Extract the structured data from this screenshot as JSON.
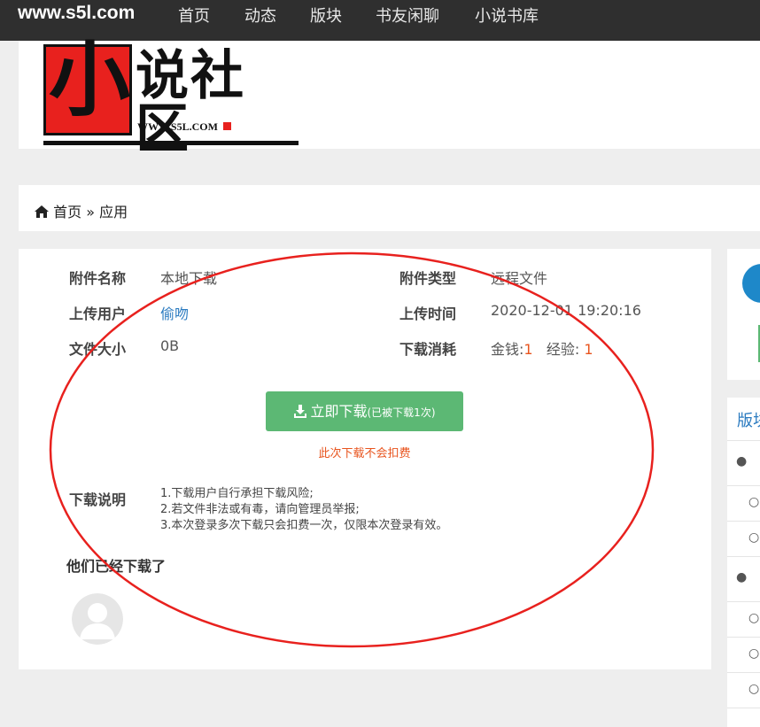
{
  "nav": {
    "brand": "www.s5l.com",
    "items": [
      "首页",
      "动态",
      "版块",
      "书友闲聊",
      "小说书库"
    ]
  },
  "logo": {
    "big_char": "小",
    "rest_chars": "说社区",
    "url_text": "WWW.S5L.COM"
  },
  "breadcrumb": {
    "home": "首页",
    "separator": "»",
    "current": "应用"
  },
  "attachment": {
    "name_label": "附件名称",
    "name_value": "本地下载",
    "type_label": "附件类型",
    "type_value": "远程文件",
    "uploader_label": "上传用户",
    "uploader_value": "偷吻",
    "upload_time_label": "上传时间",
    "upload_time_value": "2020-12-01 19:20:16",
    "size_label": "文件大小",
    "size_value": "0B",
    "cost_label": "下载消耗",
    "cost_money_label": "金钱:",
    "cost_money_value": "1",
    "cost_exp_label": "经验:",
    "cost_exp_value": "1"
  },
  "download": {
    "button_label": "立即下载",
    "button_count": "(已被下载1次)",
    "note": "此次下载不会扣费"
  },
  "instructions": {
    "label": "下载说明",
    "lines": [
      "1.下载用户自行承担下载风险;",
      "2.若文件非法或有毒，请向管理员举报;",
      "3.本次登录多次下载只会扣费一次，仅限本次登录有效。"
    ]
  },
  "downloaded": {
    "title": "他们已经下载了"
  },
  "sidebar": {
    "heading": "版块"
  },
  "colors": {
    "nav_bg": "#2f2f2f",
    "accent_green": "#5cb874",
    "link_blue": "#2b7bc0",
    "accent_orange": "#e8541e",
    "annotation_red": "#e8211e"
  }
}
